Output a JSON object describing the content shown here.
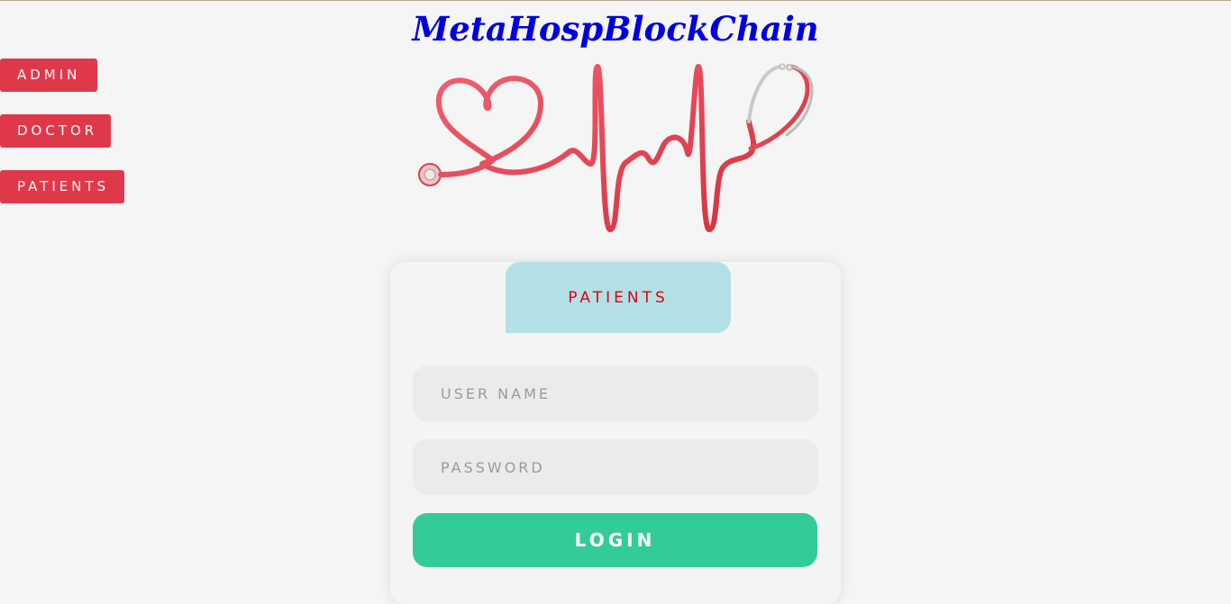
{
  "header": {
    "title": "MetaHospBlockChain",
    "title_color": "#0000e0"
  },
  "sidebar": {
    "items": [
      {
        "label": "ADMIN"
      },
      {
        "label": "DOCTOR"
      },
      {
        "label": "PATIENTS"
      }
    ],
    "button_color": "#e0384b"
  },
  "hero": {
    "image": "stethoscope-heartbeat-illustration"
  },
  "login_card": {
    "tab_label": "PATIENTS",
    "tab_color": "#b3e0e6",
    "tab_text_color": "#e0000f",
    "username_placeholder": "USER NAME",
    "password_placeholder": "PASSWORD",
    "login_label": "LOGIN",
    "login_color": "#33cc99"
  }
}
